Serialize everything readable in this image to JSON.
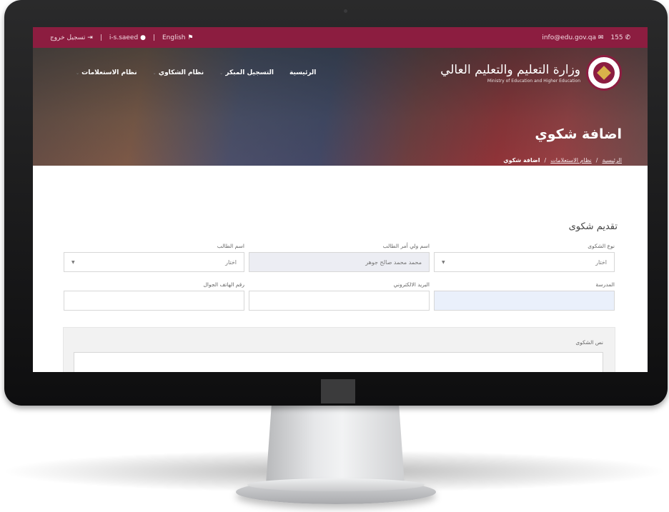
{
  "topbar": {
    "phone": "155",
    "email": "info@edu.gov.qa",
    "lang": "English",
    "user": "i-s.saeed",
    "logout": "تسجيل خروج",
    "sep1": "|",
    "sep2": "|"
  },
  "brand": {
    "arabic": "وزارة التعليم والتعليم العالي",
    "english": "Ministry of Education and Higher Education"
  },
  "nav": {
    "items": [
      {
        "label": "الرئيسية"
      },
      {
        "label": "التسجيل المبكر",
        "dropdown": true
      },
      {
        "label": "نظام الشكاوي",
        "dropdown": true
      },
      {
        "label": "نظام الاستعلامات",
        "dropdown": true
      }
    ]
  },
  "page": {
    "title": "اضافة شكوي",
    "breadcrumb": [
      "الرئيسية",
      "نظام الاستعلامات",
      "اضافة شكوي"
    ],
    "crumb_sep": "/"
  },
  "form": {
    "section_title": "تقديم شكوى",
    "complaint_type": {
      "label": "نوع الشكوى",
      "value": "اختار"
    },
    "guardian_name": {
      "label": "اسم ولي أمر الطالب",
      "value": "محمد محمد صالح جوهر"
    },
    "student_name": {
      "label": "اسم الطالب",
      "value": "اختار"
    },
    "school": {
      "label": "المدرسة",
      "value": ""
    },
    "email": {
      "label": "البريد الالكتروني",
      "value": ""
    },
    "mobile": {
      "label": "رقم الهاتف الجوال",
      "value": ""
    },
    "complaint_text": {
      "label": "نص الشكوى",
      "value": ""
    }
  },
  "colors": {
    "brand_maroon": "#8c1d40",
    "field_disabled": "#ecedf3",
    "field_blue": "#eaf0fb"
  },
  "icons": [
    "phone-icon",
    "email-icon",
    "language-flag-icon",
    "user-icon",
    "logout-icon",
    "emblem-logo",
    "chevron-down-icon"
  ]
}
